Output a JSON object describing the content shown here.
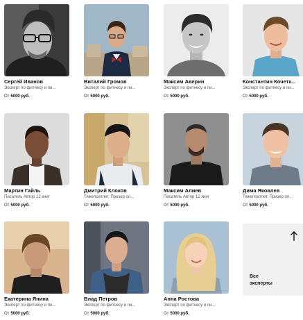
{
  "experts": [
    {
      "name": "Сергей Иванов",
      "description": "Эксперт по фитнесу и пи...",
      "price_prefix": "От",
      "price": "5000 руб."
    },
    {
      "name": "Виталий Громов",
      "description": "Эксперт по фитнесу и пи...",
      "price_prefix": "От",
      "price": "5000 руб."
    },
    {
      "name": "Максим Аверин",
      "description": "Эксперт по фитнесу и пи...",
      "price_prefix": "От",
      "price": "5000 руб."
    },
    {
      "name": "Константин Кочетк...",
      "description": "Эксперт по фитнесу и пи...",
      "price_prefix": "От",
      "price": "5000 руб."
    },
    {
      "name": "Мартин Гайль",
      "description": "Писатель Автор 12 книг",
      "price_prefix": "От",
      "price": "5000 руб."
    },
    {
      "name": "Дмитрий Клоков",
      "description": "Тяжелоатлет, Призер ол...",
      "price_prefix": "От",
      "price": "5000 руб."
    },
    {
      "name": "Максим Алиев",
      "description": "Писатель Автор 12 книг",
      "price_prefix": "От",
      "price": "5000 руб."
    },
    {
      "name": "Дима Яковлев",
      "description": "Тяжелоатлет, Призер ол...",
      "price_prefix": "От",
      "price": "5000 руб."
    },
    {
      "name": "Екатерина Янина",
      "description": "Эксперт по фитнесу и пи...",
      "price_prefix": "От",
      "price": "5000 руб."
    },
    {
      "name": "Влад Петров",
      "description": "Эксперт по фитнесу и пи...",
      "price_prefix": "От",
      "price": "5000 руб."
    },
    {
      "name": "Анна Ростова",
      "description": "Эксперт по фитнесу и пи...",
      "price_prefix": "От",
      "price": "5000 руб."
    }
  ],
  "all_experts": {
    "label_line1": "Все",
    "label_line2": "эксперты",
    "icon": "arrow-up-icon"
  }
}
